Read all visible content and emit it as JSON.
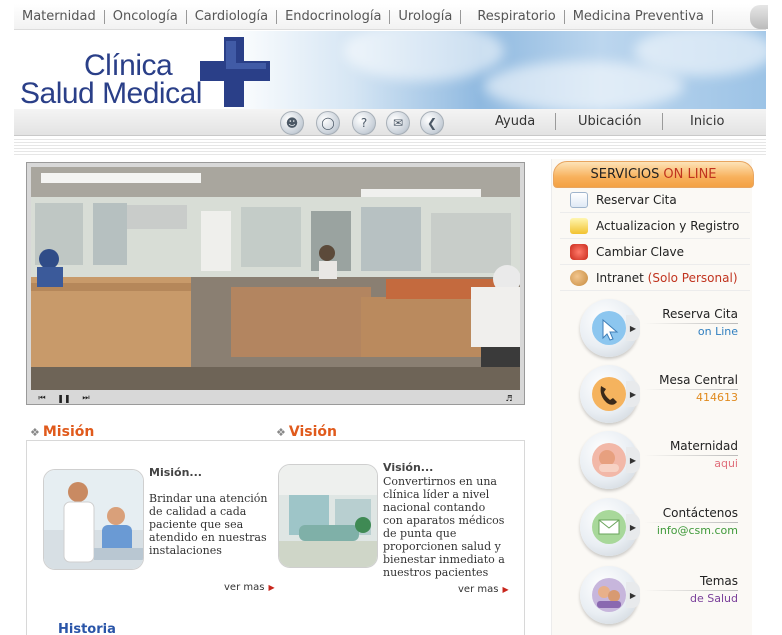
{
  "top_nav": {
    "items": [
      "Maternidad",
      "Oncología",
      "Cardiología",
      "Endocrinología",
      "Urología",
      "Respiratorio",
      "Medicina Preventiva"
    ]
  },
  "logo": {
    "line1": "Clínica",
    "line2": "Salud Medical"
  },
  "sub_nav": {
    "icons": [
      "people-icon",
      "chat-icon",
      "help-icon",
      "mail-icon",
      "back-icon"
    ],
    "links": [
      "Ayuda",
      "Ubicación",
      "Inicio"
    ]
  },
  "video": {
    "controls": [
      "prev-icon",
      "pause-icon",
      "next-icon",
      "volume-icon"
    ]
  },
  "mision": {
    "heading": "Misión",
    "title": "Misión...",
    "text": "Brindar una atención de calidad a cada paciente que sea atendido en nuestras instalaciones",
    "more": "ver mas"
  },
  "vision": {
    "heading": "Visión",
    "title": "Visión...",
    "text": "Convertirnos en una clínica líder a nivel nacional contando con aparatos médicos de punta que proporcionen salud y bienestar inmediato a nuestros pacientes",
    "more": "ver mas"
  },
  "historia": "Historia",
  "services": {
    "header_main": "SERVICIOS",
    "header_accent": "ON LINE",
    "items": [
      {
        "label": "Reservar Cita",
        "icon": "checklist-icon"
      },
      {
        "label": "Actualizacion y Registro",
        "icon": "pencil-icon"
      },
      {
        "label": "Cambiar Clave",
        "icon": "power-icon"
      },
      {
        "label": "Intranet",
        "accent": "(Solo Personal)",
        "icon": "users-icon"
      }
    ]
  },
  "cards": [
    {
      "line1": "Reserva Cita",
      "line2": "on Line",
      "line2_color": "#2f7fc0",
      "icon": "cursor-icon"
    },
    {
      "line1": "Mesa Central",
      "line2": "414613",
      "line2_color": "#e08a1e",
      "icon": "phone-icon"
    },
    {
      "line1": "Maternidad",
      "line2": "aqui",
      "line2_color": "#e0707c",
      "icon": "baby-icon"
    },
    {
      "line1": "Contáctenos",
      "line2": "info@csm.com",
      "line2_color": "#3f9a3a",
      "icon": "envelope-icon"
    },
    {
      "line1": "Temas",
      "line2": "de Salud",
      "line2_color": "#7a3f9a",
      "icon": "family-icon"
    }
  ],
  "colors": {
    "brand": "#2a3f88",
    "accent_orange": "#e05a1c",
    "services_header": "#f8b15c"
  }
}
